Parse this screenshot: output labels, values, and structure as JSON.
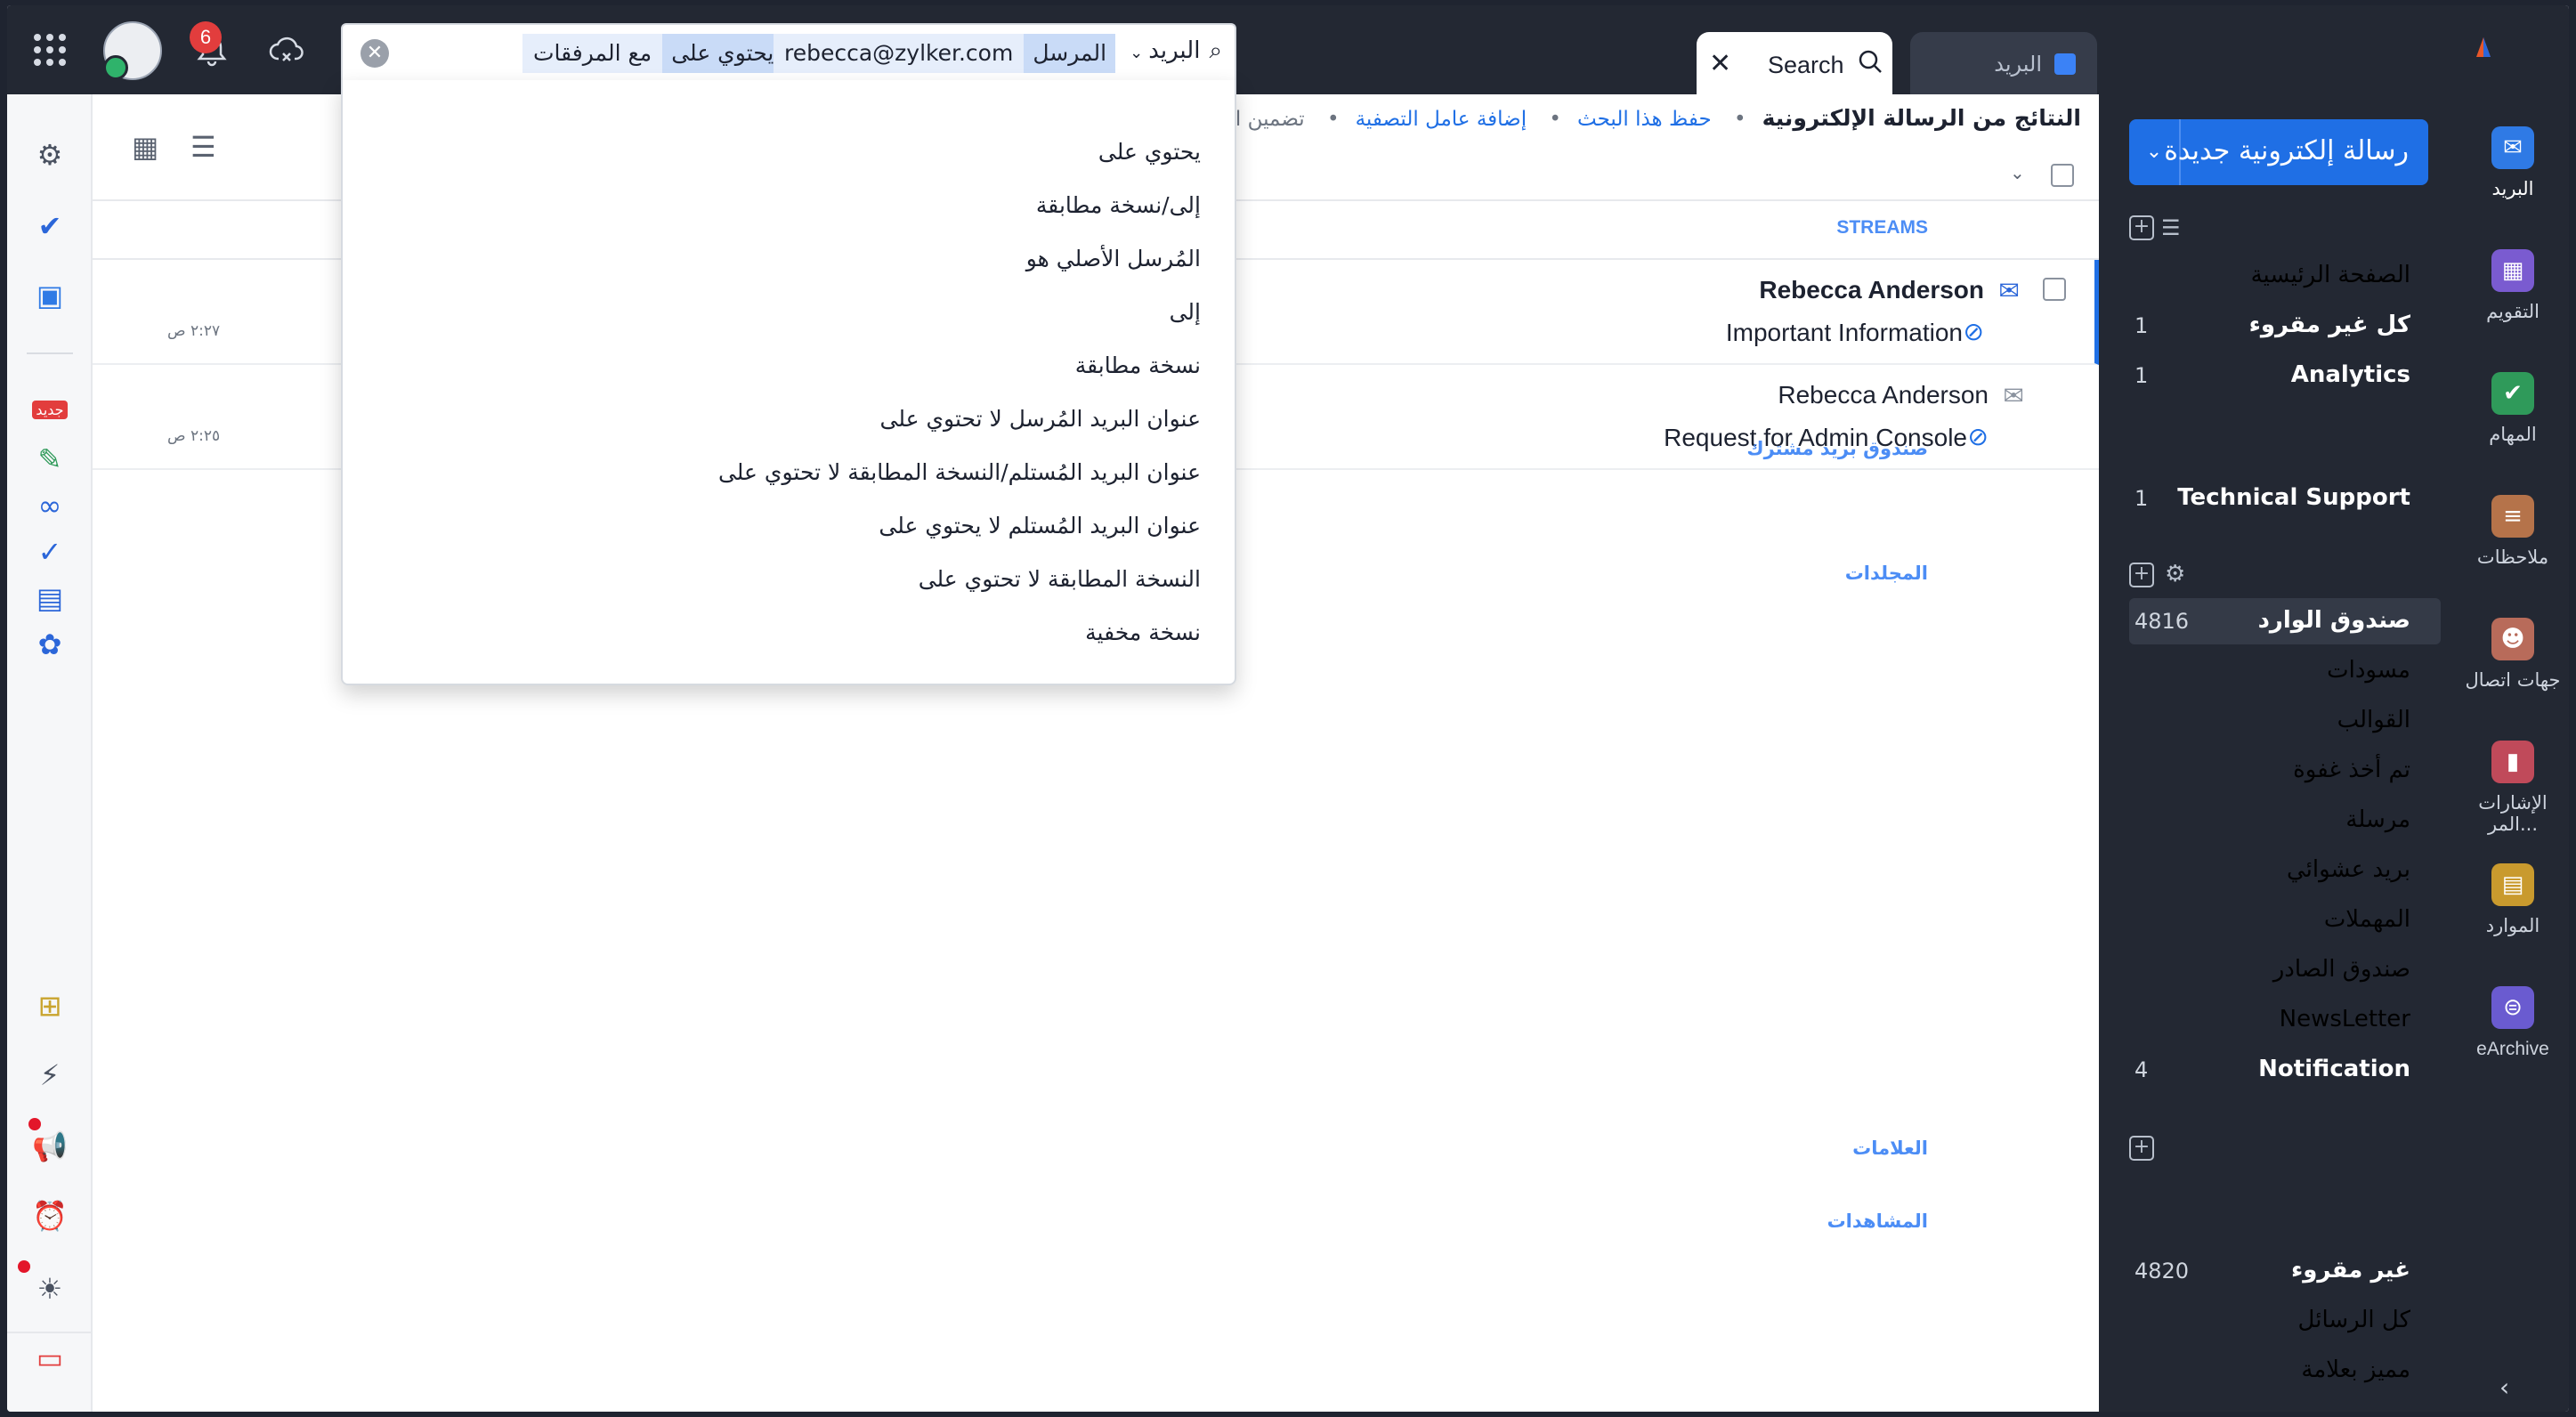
{
  "topbar": {
    "notification_count": "6",
    "tabs": [
      {
        "label": "Search"
      },
      {
        "label": "البريد"
      }
    ]
  },
  "search": {
    "scope": "البريد",
    "chips": [
      {
        "key": "المرسل",
        "value": "rebecca@zylker.com"
      },
      {
        "key": "يحتوي على",
        "value": "مع المرفقات"
      }
    ],
    "options": [
      "يحتوي على",
      "إلى/نسخة مطابقة",
      "المُرسل الأصلي هو",
      "إلى",
      "نسخة مطابقة",
      "عنوان البريد المُرسل لا تحتوي على",
      "عنوان البريد المُستلم/النسخة المطابقة لا تحتوي على",
      "عنوان البريد المُستلم لا يحتوي على",
      "النسخة المطابقة لا تحتوي على",
      "نسخة مخفية"
    ]
  },
  "content": {
    "title": "النتائج من الرسالة الإلكترونية",
    "links": [
      "حفظ هذا البحث",
      "إضافة عامل التصفية"
    ],
    "muted": "تضمين الرسائل الإل",
    "emails": [
      {
        "from": "Rebecca Anderson",
        "subject": "Important Information",
        "time": "٢:٢٧ ص",
        "unread": true
      },
      {
        "from": "Rebecca Anderson",
        "subject": "Request for Admin Console",
        "time": "٢:٢٥ ص",
        "unread": false
      }
    ]
  },
  "nav": {
    "new_mail": "رسالة إلكترونية جديدة",
    "streams_header": "STREAMS",
    "streams": [
      {
        "label": "الصفحة الرئيسية",
        "count": ""
      },
      {
        "label": "كل غير مقروء",
        "count": "1"
      },
      {
        "label": "Analytics",
        "count": "1"
      }
    ],
    "shared_header": "صندوق بريد مشترك",
    "shared": [
      {
        "label": "Technical Support",
        "count": "1"
      }
    ],
    "folders_header": "المجلدات",
    "folders": [
      {
        "label": "صندوق الوارد",
        "count": "4816"
      },
      {
        "label": "مسودات",
        "count": ""
      },
      {
        "label": "القوالب",
        "count": ""
      },
      {
        "label": "تم أخذ غفوة",
        "count": ""
      },
      {
        "label": "مرسلة",
        "count": ""
      },
      {
        "label": "بريد عشوائي",
        "count": ""
      },
      {
        "label": "المهملات",
        "count": ""
      },
      {
        "label": "صندوق الصادر",
        "count": ""
      },
      {
        "label": "NewsLetter",
        "count": ""
      },
      {
        "label": "Notification",
        "count": "4"
      }
    ],
    "tags_header": "العلامات",
    "views_header": "المشاهدات",
    "views": [
      {
        "label": "غير مقروء",
        "count": "4820"
      },
      {
        "label": "كل الرسائل",
        "count": ""
      },
      {
        "label": "مميز بعلامة",
        "count": ""
      }
    ]
  },
  "modules": [
    {
      "label": "البريد",
      "icon": "mail-icon",
      "color": "#2f7ae5"
    },
    {
      "label": "التقويم",
      "icon": "calendar-icon",
      "color": "#7a5bd0"
    },
    {
      "label": "المهام",
      "icon": "check-icon",
      "color": "#2f9a5a"
    },
    {
      "label": "ملاحظات",
      "icon": "notes-icon",
      "color": "#b5734a"
    },
    {
      "label": "جهات اتصال",
      "icon": "contacts-icon",
      "color": "#b86b5a"
    },
    {
      "label": "الإشارات المر...",
      "icon": "bookmark-icon",
      "color": "#c04a5a"
    },
    {
      "label": "الموارد",
      "icon": "resources-icon",
      "color": "#c99a2e"
    },
    {
      "label": "eArchive",
      "icon": "archive-icon",
      "color": "#6a5bd0"
    }
  ],
  "left_rail": {
    "new_badge": "جديد"
  }
}
